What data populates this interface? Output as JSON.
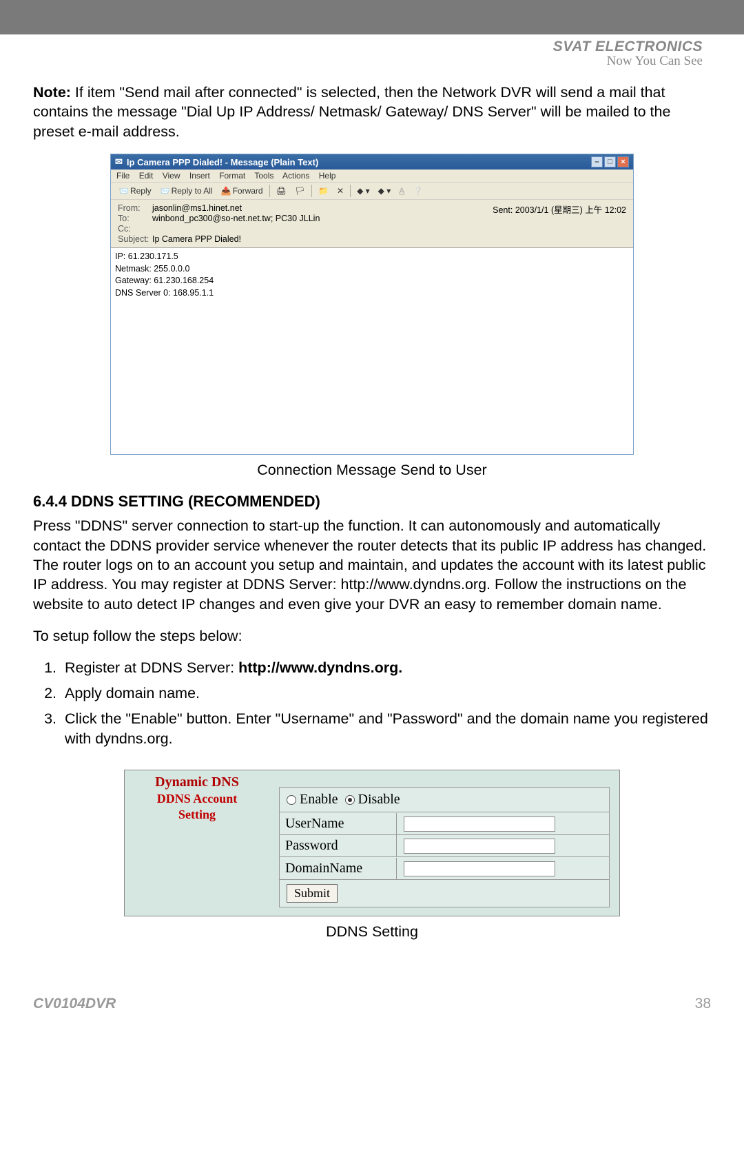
{
  "header": {
    "brand": "SVAT ELECTRONICS",
    "tagline": "Now You Can See"
  },
  "note": {
    "label": "Note:",
    "text": " If item \"Send mail after connected\" is selected, then the Network DVR will send a mail that contains the message \"Dial Up IP Address/ Netmask/ Gateway/ DNS Server\" will be mailed to the preset e-mail address."
  },
  "email": {
    "title": "Ip Camera PPP Dialed! - Message (Plain Text)",
    "menus": [
      "File",
      "Edit",
      "View",
      "Insert",
      "Format",
      "Tools",
      "Actions",
      "Help"
    ],
    "toolbar": {
      "reply": "Reply",
      "replyall": "Reply to All",
      "forward": "Forward"
    },
    "from_lbl": "From:",
    "from_val": "jasonlin@ms1.hinet.net",
    "to_lbl": "To:",
    "to_val": "winbond_pc300@so-net.net.tw; PC30 JLLin",
    "cc_lbl": "Cc:",
    "subj_lbl": "Subject:",
    "subj_val": "Ip Camera PPP Dialed!",
    "sent_lbl": "Sent:",
    "sent_val": "2003/1/1 (星期三) 上午 12:02",
    "body_lines": [
      "IP: 61.230.171.5",
      "Netmask: 255.0.0.0",
      "Gateway: 61.230.168.254",
      "DNS Server 0: 168.95.1.1"
    ]
  },
  "caption1": "Connection Message Send to User",
  "section_title": "6.4.4 DDNS SETTING (RECOMMENDED)",
  "ddns_para": "Press \"DDNS\" server connection to start-up the function. It can autonomously and automatically contact the DDNS provider service whenever the router detects that its public IP address has changed. The router logs on to an account you setup and maintain, and updates the account with its latest public IP address. You may register at DDNS Server: http://www.dyndns.org. Follow the instructions on the website to auto detect IP changes and even give your DVR an easy to remember domain name.",
  "steps_intro": "To setup follow the steps below:",
  "steps": [
    {
      "pre": "Register at DDNS Server: ",
      "bold": "http://www.dyndns.org."
    },
    {
      "pre": "Apply domain name.",
      "bold": ""
    },
    {
      "pre": "Click the \"Enable\" button. Enter \"Username\" and \"Password\" and the domain name you registered with dyndns.org.",
      "bold": ""
    }
  ],
  "ddns_panel": {
    "h1": "Dynamic DNS",
    "h2a": "DDNS Account",
    "h2b": "Setting",
    "enable": "Enable",
    "disable": "Disable",
    "user": "UserName",
    "pass": "Password",
    "domain": "DomainName",
    "submit": "Submit"
  },
  "caption2": "DDNS Setting",
  "footer": {
    "model": "CV0104DVR",
    "page": "38"
  }
}
